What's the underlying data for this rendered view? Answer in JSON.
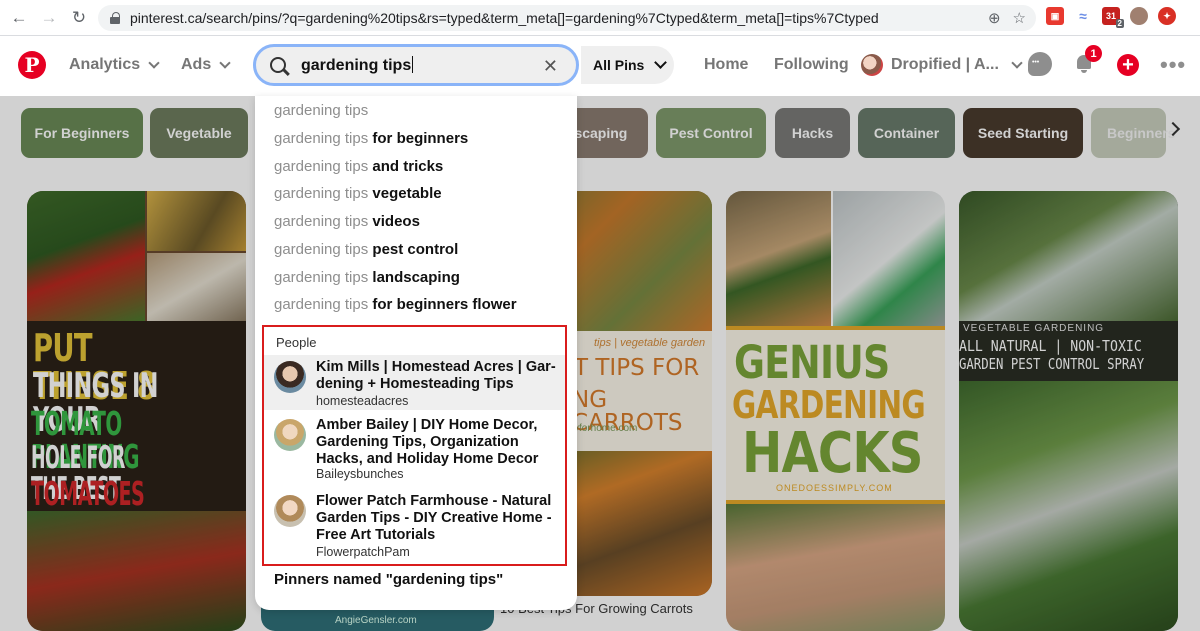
{
  "browser": {
    "url": "pinterest.ca/search/pins/?q=gardening%20tips&rs=typed&term_meta[]=gardening%7Ctyped&term_meta[]=tips%7Ctyped",
    "back_icon": "arrow-left",
    "forward_icon": "arrow-right",
    "reload_icon": "reload",
    "ext_badge": "2"
  },
  "header": {
    "logo_letter": "P",
    "nav_analytics": "Analytics",
    "nav_ads": "Ads",
    "search_value": "gardening tips",
    "clear_icon": "✕",
    "all_pins": "All Pins",
    "nav_home": "Home",
    "nav_following": "Following",
    "account_name": "Dropified | A...",
    "notification_count": "1",
    "more_icon": "•••"
  },
  "chips": [
    {
      "label": "For Beginners",
      "color": "#6b8a57"
    },
    {
      "label": "Vegetable",
      "color": "#6e7d5f"
    },
    {
      "label": "Landscaping",
      "color": "#8a7c71"
    },
    {
      "label": "Pest Control",
      "color": "#7f9a6c"
    },
    {
      "label": "Hacks",
      "color": "#7a7b78"
    },
    {
      "label": "Container",
      "color": "#6a7c6c"
    },
    {
      "label": "Seed Starting",
      "color": "#4a3b2e"
    },
    {
      "label": "Beginners",
      "color": "#c8cfbe"
    }
  ],
  "pins": {
    "p1_line1": "PUT THESE 8",
    "p1_line2": "THINGS IN YOUR",
    "p1_line3": "TOMATO PLANTING",
    "p1_line4": "HOLE FOR THE BEST",
    "p1_line5": "TOMATOES EVER!",
    "p1_credit": "AngieGensler.com",
    "p2_tag": "tips | vegetable garden",
    "p2_line1": "T TIPS FOR",
    "p2_line2": "NG CARROTS",
    "p2_site": "yforhome.com",
    "p2_caption": "10 Best Tips For Growing Carrots",
    "p3_line1": "GENIUS",
    "p3_line2": "GARDENING",
    "p3_line3": "HACKS",
    "p3_site": "ONEDOESSIMPLY.COM",
    "p4_tag": "VEGETABLE GARDENING",
    "p4_line1": "ALL NATURAL | NON-TOXIC",
    "p4_line2": "GARDEN PEST CONTROL SPRAY"
  },
  "dropdown": {
    "suggestions": [
      {
        "query": "gardening tips",
        "rest": ""
      },
      {
        "query": "gardening tips",
        "rest": " for beginners"
      },
      {
        "query": "gardening tips",
        "rest": " and tricks"
      },
      {
        "query": "gardening tips",
        "rest": " vegetable"
      },
      {
        "query": "gardening tips",
        "rest": " videos"
      },
      {
        "query": "gardening tips",
        "rest": " pest control"
      },
      {
        "query": "gardening tips",
        "rest": " landscaping"
      },
      {
        "query": "gardening tips",
        "rest": " for beginners flower"
      }
    ],
    "people_label": "People",
    "people": [
      {
        "name": "Kim Mills | Homestead Acres | Gar-dening + Homesteading Tips",
        "username": "homesteadacres"
      },
      {
        "name": "Amber Bailey | DIY Home Decor, Gardening Tips, Organization Hacks, and Holiday Home Decor",
        "username": "Baileysbunches"
      },
      {
        "name": "Flower Patch Farmhouse - Natural Garden Tips - DIY Creative Home - Free Art Tutorials",
        "username": "FlowerpatchPam"
      }
    ],
    "pinners_named": "Pinners named \"gardening tips\""
  }
}
